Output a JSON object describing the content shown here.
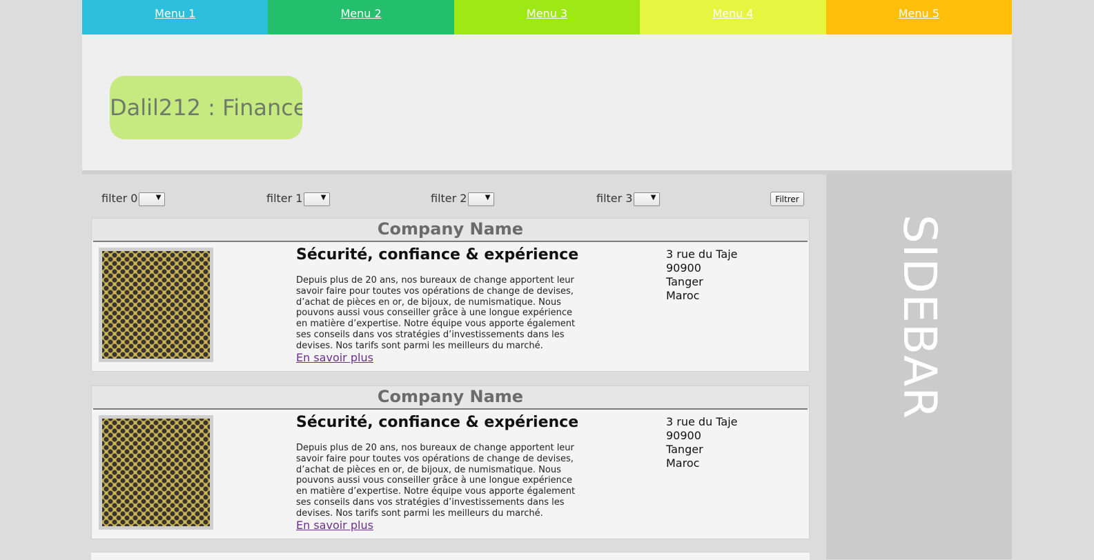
{
  "nav": {
    "items": [
      "Menu 1",
      "Menu 2",
      "Menu 3",
      "Menu 4",
      "Menu 5"
    ],
    "colors": [
      "#2cbfdb",
      "#23bf6d",
      "#9ee816",
      "#e6f53f",
      "#ffbf08"
    ]
  },
  "header": {
    "logo_text": "Dalil212 : Finance"
  },
  "filters": {
    "items": [
      {
        "label": "filter 0",
        "value": ""
      },
      {
        "label": "filter 1",
        "value": ""
      },
      {
        "label": "filter 2",
        "value": ""
      },
      {
        "label": "filter 3",
        "value": ""
      }
    ],
    "submit_label": "Filtrer"
  },
  "sidebar": {
    "label": "SIDEBAR"
  },
  "listings": [
    {
      "company_name": "Company Name",
      "title": "Sécurité, confiance & expérience",
      "description": "Depuis plus de 20 ans, nos bureaux de change apportent leur savoir faire pour toutes vos opérations de change de devises, d’achat de pièces en or, de bijoux, de numismatique. Nous pouvons aussi vous conseiller grâce à une longue expérience en matière d’expertise. Notre équipe vous apporte également ses conseils dans vos stratégies d’investissements dans les devises. Nos tarifs sont parmi les meilleurs du marché.",
      "link_label": "En savoir plus",
      "address": [
        "3 rue du Taje",
        "90900",
        "Tanger",
        "Maroc"
      ]
    },
    {
      "company_name": "Company Name",
      "title": "Sécurité, confiance & expérience",
      "description": "Depuis plus de 20 ans, nos bureaux de change apportent leur savoir faire pour toutes vos opérations de change de devises, d’achat de pièces en or, de bijoux, de numismatique. Nous pouvons aussi vous conseiller grâce à une longue expérience en matière d’expertise. Notre équipe vous apporte également ses conseils dans vos stratégies d’investissements dans les devises. Nos tarifs sont parmi les meilleurs du marché.",
      "link_label": "En savoir plus",
      "address": [
        "3 rue du Taje",
        "90900",
        "Tanger",
        "Maroc"
      ]
    }
  ]
}
